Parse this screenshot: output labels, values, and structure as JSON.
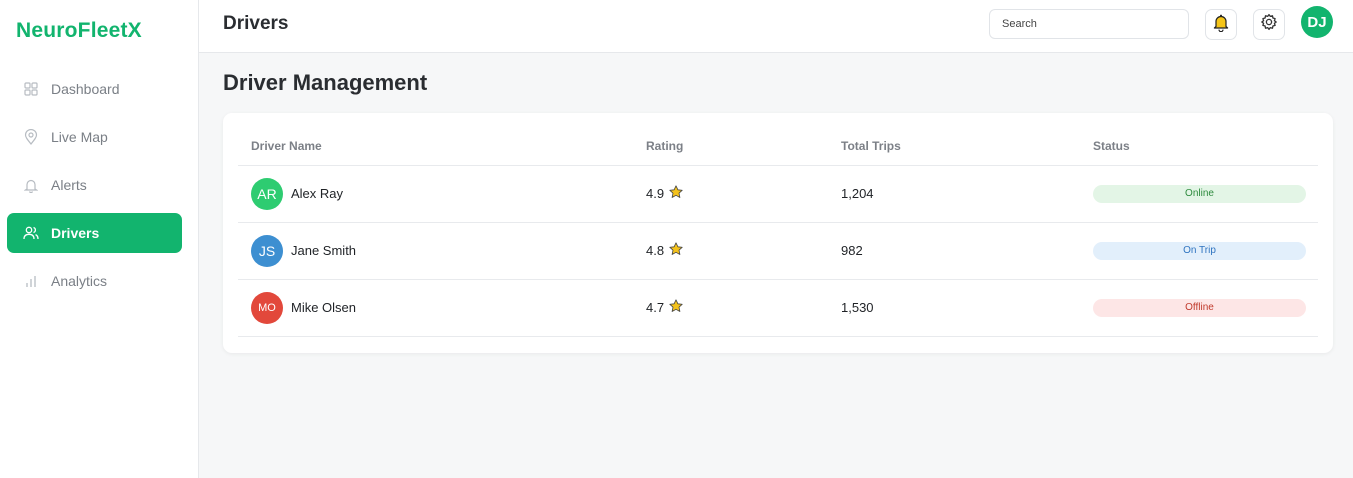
{
  "app": {
    "name": "NeuroFleetX"
  },
  "sidebar": {
    "items": [
      {
        "label": "Dashboard",
        "icon": "grid-icon",
        "active": false
      },
      {
        "label": "Live Map",
        "icon": "map-pin-icon",
        "active": false
      },
      {
        "label": "Alerts",
        "icon": "bell-icon",
        "active": false
      },
      {
        "label": "Drivers",
        "icon": "users-icon",
        "active": true
      },
      {
        "label": "Analytics",
        "icon": "bar-chart-icon",
        "active": false
      }
    ]
  },
  "header": {
    "title": "Drivers",
    "search_placeholder": "Search",
    "notification_icon": "bell-icon",
    "settings_icon": "gear-icon",
    "user_initials": "DJ"
  },
  "main": {
    "title": "Driver Management",
    "table": {
      "columns": [
        "Driver Name",
        "Rating",
        "Total Trips",
        "Status"
      ],
      "rows": [
        {
          "initials": "AR",
          "avatar_color": "#2ecc71",
          "name": "Alex Ray",
          "rating": "4.9",
          "trips": "1,204",
          "status": "Online",
          "status_bg": "#e3f5e6",
          "status_fg": "#2e8b3e"
        },
        {
          "initials": "JS",
          "avatar_color": "#3d8fd1",
          "name": "Jane Smith",
          "rating": "4.8",
          "trips": "982",
          "status": "On Trip",
          "status_bg": "#e2effb",
          "status_fg": "#2f74c0"
        },
        {
          "initials": "MO",
          "avatar_color": "#e2483b",
          "name": "Mike Olsen",
          "rating": "4.7",
          "trips": "1,530",
          "status": "Offline",
          "status_bg": "#fde6e6",
          "status_fg": "#c0392b"
        }
      ]
    }
  },
  "colors": {
    "accent": "#12b46e",
    "star": "#f4c21b"
  }
}
